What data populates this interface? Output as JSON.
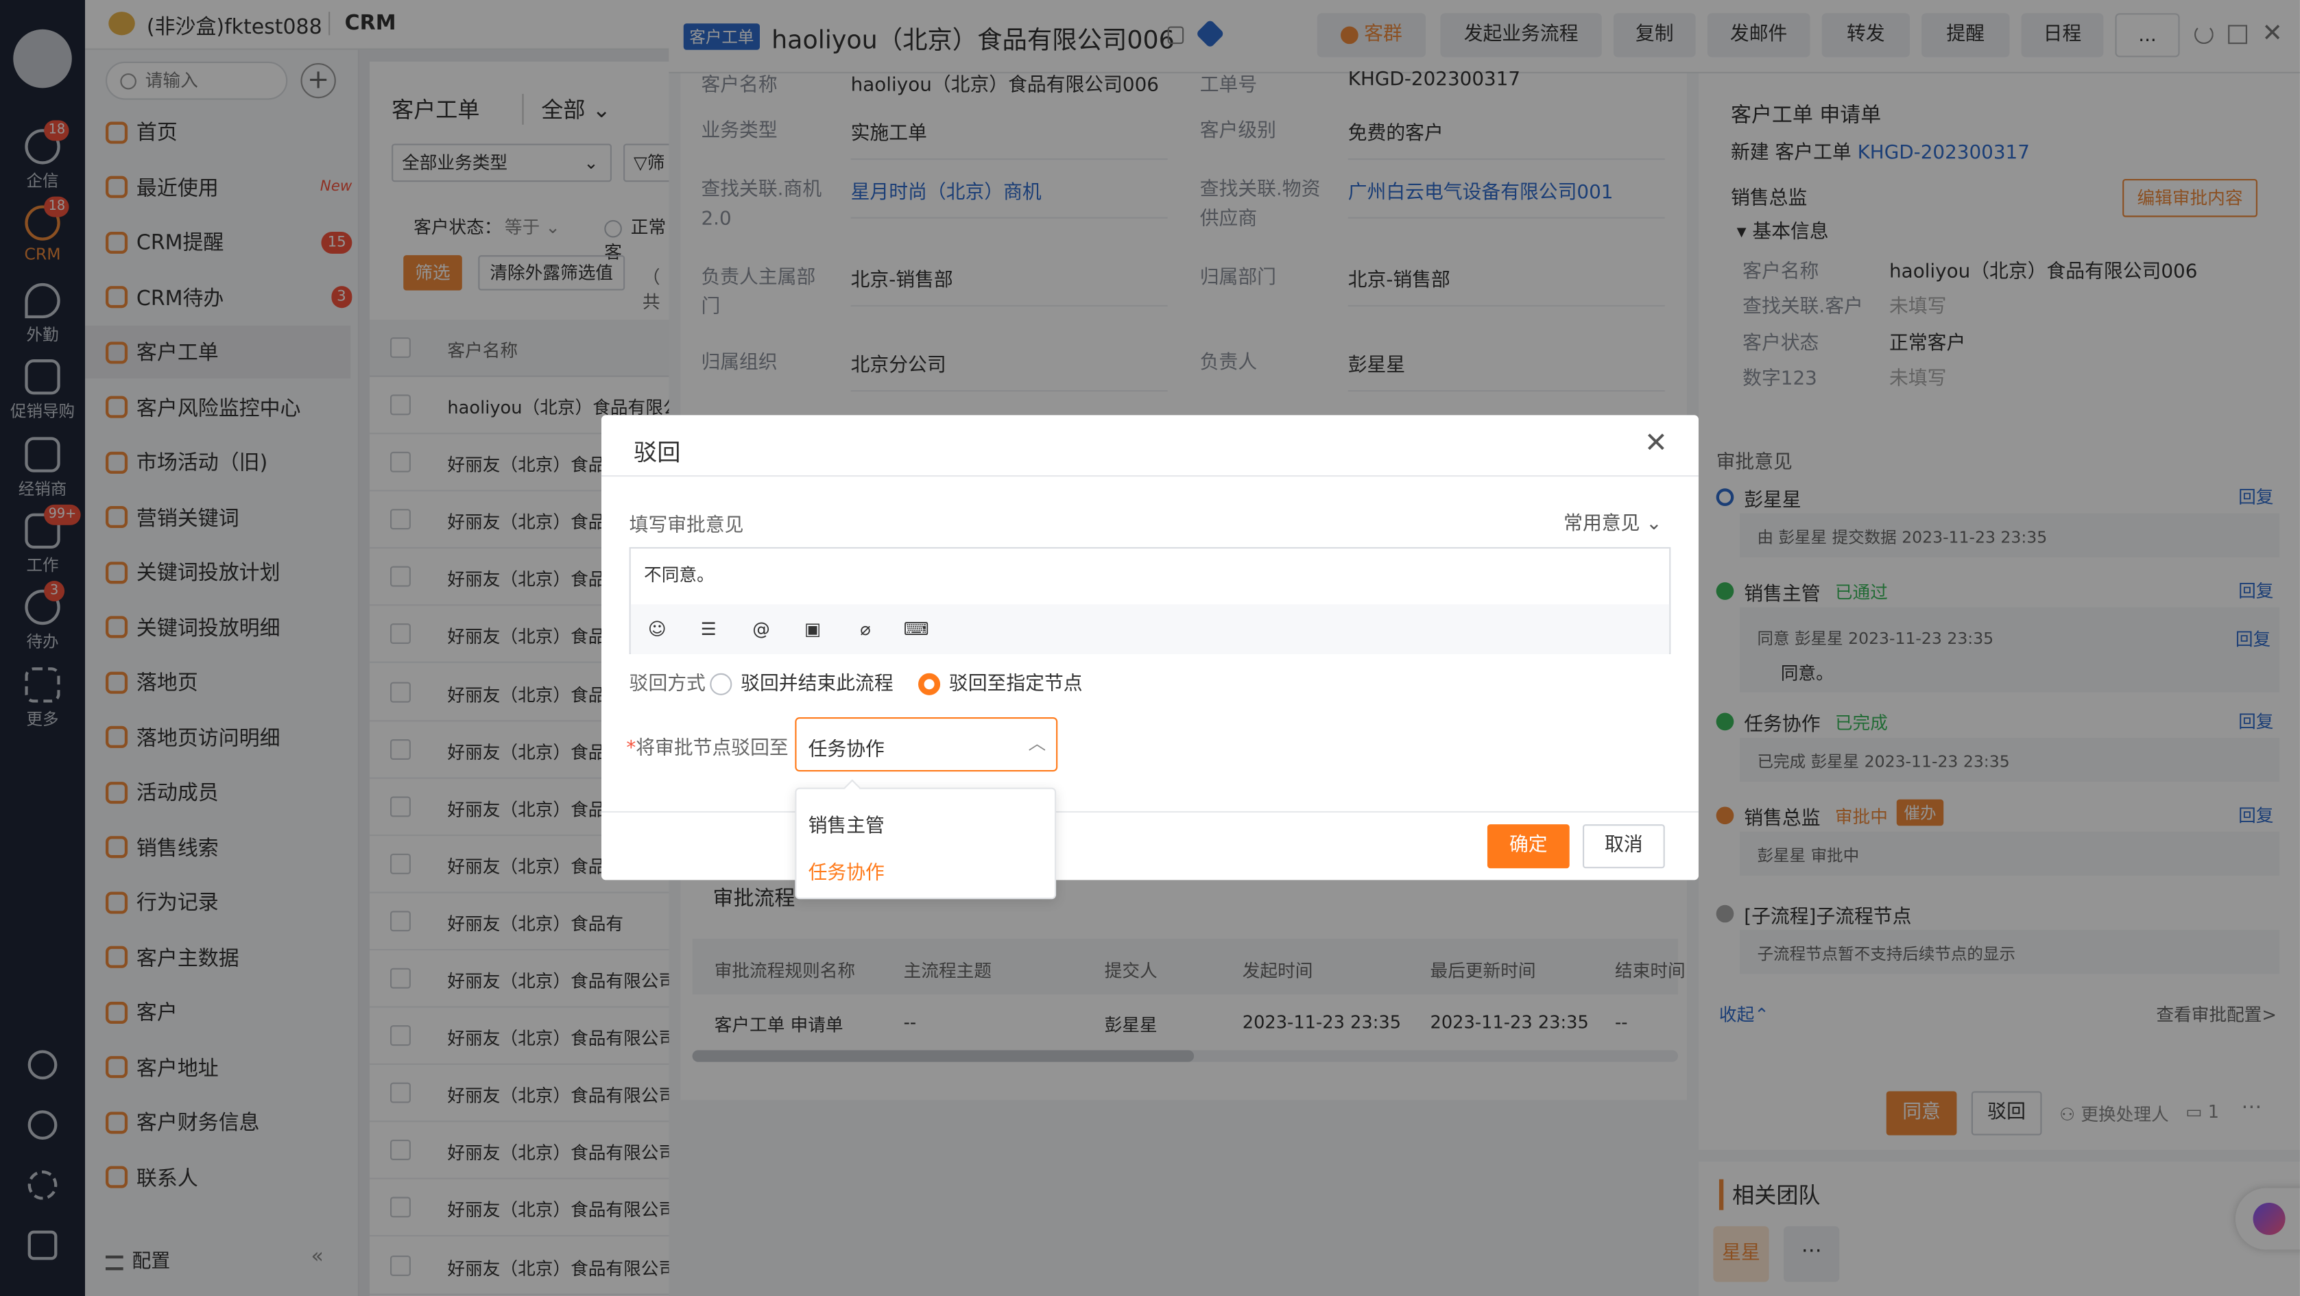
{
  "rail": {
    "items": [
      {
        "label": "企信",
        "badge": "18"
      },
      {
        "label": "CRM",
        "badge": "18"
      },
      {
        "label": "外勤",
        "badge": ""
      },
      {
        "label": "促销导购",
        "badge": ""
      },
      {
        "label": "经销商",
        "badge": ""
      },
      {
        "label": "工作",
        "badge": "99+"
      },
      {
        "label": "待办",
        "badge": "3"
      },
      {
        "label": "更多",
        "badge": ""
      }
    ]
  },
  "topbar": {
    "org": "(非沙盒)fktest088",
    "app": "CRM"
  },
  "sidebar": {
    "search_placeholder": "请输入",
    "items": [
      {
        "label": "首页",
        "tag": ""
      },
      {
        "label": "最近使用",
        "tag": "New"
      },
      {
        "label": "CRM提醒",
        "tag": "15"
      },
      {
        "label": "CRM待办",
        "tag": "3"
      },
      {
        "label": "客户工单",
        "tag": ""
      },
      {
        "label": "客户风险监控中心",
        "tag": ""
      },
      {
        "label": "市场活动（旧)",
        "tag": ""
      },
      {
        "label": "营销关键词",
        "tag": ""
      },
      {
        "label": "关键词投放计划",
        "tag": ""
      },
      {
        "label": "关键词投放明细",
        "tag": ""
      },
      {
        "label": "落地页",
        "tag": ""
      },
      {
        "label": "落地页访问明细",
        "tag": ""
      },
      {
        "label": "活动成员",
        "tag": ""
      },
      {
        "label": "销售线索",
        "tag": ""
      },
      {
        "label": "行为记录",
        "tag": ""
      },
      {
        "label": "客户主数据",
        "tag": ""
      },
      {
        "label": "客户",
        "tag": ""
      },
      {
        "label": "客户地址",
        "tag": ""
      },
      {
        "label": "客户财务信息",
        "tag": ""
      },
      {
        "label": "联系人",
        "tag": ""
      }
    ],
    "config": "配置"
  },
  "list": {
    "title": "客户工单",
    "scope": "全部",
    "type_select": "全部业务类型",
    "filter_label": "筛",
    "status_label": "客户状态：",
    "status_op": "等于",
    "status_opt": "正常客",
    "filter_btn": "筛选",
    "clear_btn": "清除外露筛选值",
    "paren": "（ 共",
    "col_name": "客户名称",
    "rows": [
      "haoliyou（北京）食品有限公司",
      "好丽友（北京）食品有",
      "好丽友（北京）食品有",
      "好丽友（北京）食品有",
      "好丽友（北京）食品有",
      "好丽友（北京）食品有",
      "好丽友（北京）食品有",
      "好丽友（北京）食品有",
      "好丽友（北京）食品有",
      "好丽友（北京）食品有",
      "好丽友（北京）食品有限公司1",
      "好丽友（北京）食品有限公司1",
      "好丽友（北京）食品有限公司",
      "好丽友（北京）食品有限公司1",
      "好丽友（北京）食品有限公司1",
      "好丽友（北京）食品有限公司1"
    ]
  },
  "detail": {
    "tag": "客户工单",
    "title": "haoliyou（北京）食品有限公司006",
    "actions": [
      "客群",
      "发起业务流程",
      "复制",
      "发邮件",
      "转发",
      "提醒",
      "日程",
      "..."
    ],
    "fields_top_left": "客户名称",
    "fields_top_left_val": "haoliyou（北京）食品有限公司006",
    "fields_top_right": "工单号",
    "fields_top_right_val": "KHGD-202300317",
    "fields": [
      {
        "l1": "业务类型",
        "v1": "实施工单",
        "l2": "客户级别",
        "v2": "免费的客户"
      },
      {
        "l1": "查找关联.商机2.0",
        "v1": "星月时尚（北京）商机",
        "l2": "查找关联.物资供应商",
        "v2": "广州白云电气设备有限公司001"
      },
      {
        "l1": "负责人主属部门",
        "v1": "北京-销售部",
        "l2": "归属部门",
        "v2": "北京-销售部"
      },
      {
        "l1": "归属组织",
        "v1": "北京分公司",
        "l2": "负责人",
        "v2": "彭星星"
      }
    ],
    "approval_flow_title": "审批流程",
    "table_headers": [
      "审批流程规则名称",
      "主流程主题",
      "提交人",
      "发起时间",
      "最后更新时间",
      "结束时间"
    ],
    "table_row": [
      "客户工单 申请单",
      "--",
      "彭星星",
      "2023-11-23 23:35",
      "2023-11-23 23:35",
      "--"
    ]
  },
  "approval": {
    "title": "客户工单 申请单",
    "subtitle_prefix": "新建 客户工单",
    "subtitle_link": "KHGD-202300317",
    "role": "销售总监",
    "edit_btn": "编辑审批内容",
    "basic_info": "基本信息",
    "info": [
      {
        "label": "客户名称",
        "value": "haoliyou（北京）食品有限公司006"
      },
      {
        "label": "查找关联.客户",
        "value": "未填写"
      },
      {
        "label": "客户状态",
        "value": "正常客户"
      },
      {
        "label": "数字123",
        "value": "未填写"
      }
    ],
    "opinions_title": "审批意见",
    "reply": "回复",
    "timeline": [
      {
        "name": "彭星星",
        "status": "",
        "detail": "由 彭星星 提交数据 2023-11-23 23:35"
      },
      {
        "name": "销售主管",
        "status": "已通过",
        "detail": "同意 彭星星 2023-11-23 23:35",
        "comment": "同意。"
      },
      {
        "name": "任务协作",
        "status": "已完成",
        "detail": "已完成 彭星星 2023-11-23 23:35"
      },
      {
        "name": "销售总监",
        "status": "审批中",
        "urge": "催办",
        "detail": "彭星星 审批中"
      },
      {
        "name": "[子流程]子流程节点",
        "status": "",
        "detail": "子流程节点暂不支持后续节点的显示"
      }
    ],
    "collapse": "收起",
    "view_config": "查看审批配置>",
    "agree": "同意",
    "reject": "驳回",
    "change_handler": "更换处理人",
    "comment_count": "1",
    "team_title": "相关团队",
    "team_member": "星星"
  },
  "dialog": {
    "title": "驳回",
    "opinion_label": "填写审批意见",
    "common_opinion": "常用意见",
    "opinion_text": "不同意。",
    "method_label": "驳回方式",
    "method_opt1": "驳回并结束此流程",
    "method_opt2": "驳回至指定节点",
    "node_label": "将审批节点驳回至",
    "node_value": "任务协作",
    "options": [
      "销售主管",
      "任务协作"
    ],
    "confirm": "确定",
    "cancel": "取消"
  },
  "colors": {
    "accent": "#ff7a1a",
    "link": "#2f6bcb",
    "rail": "#1f2737"
  }
}
